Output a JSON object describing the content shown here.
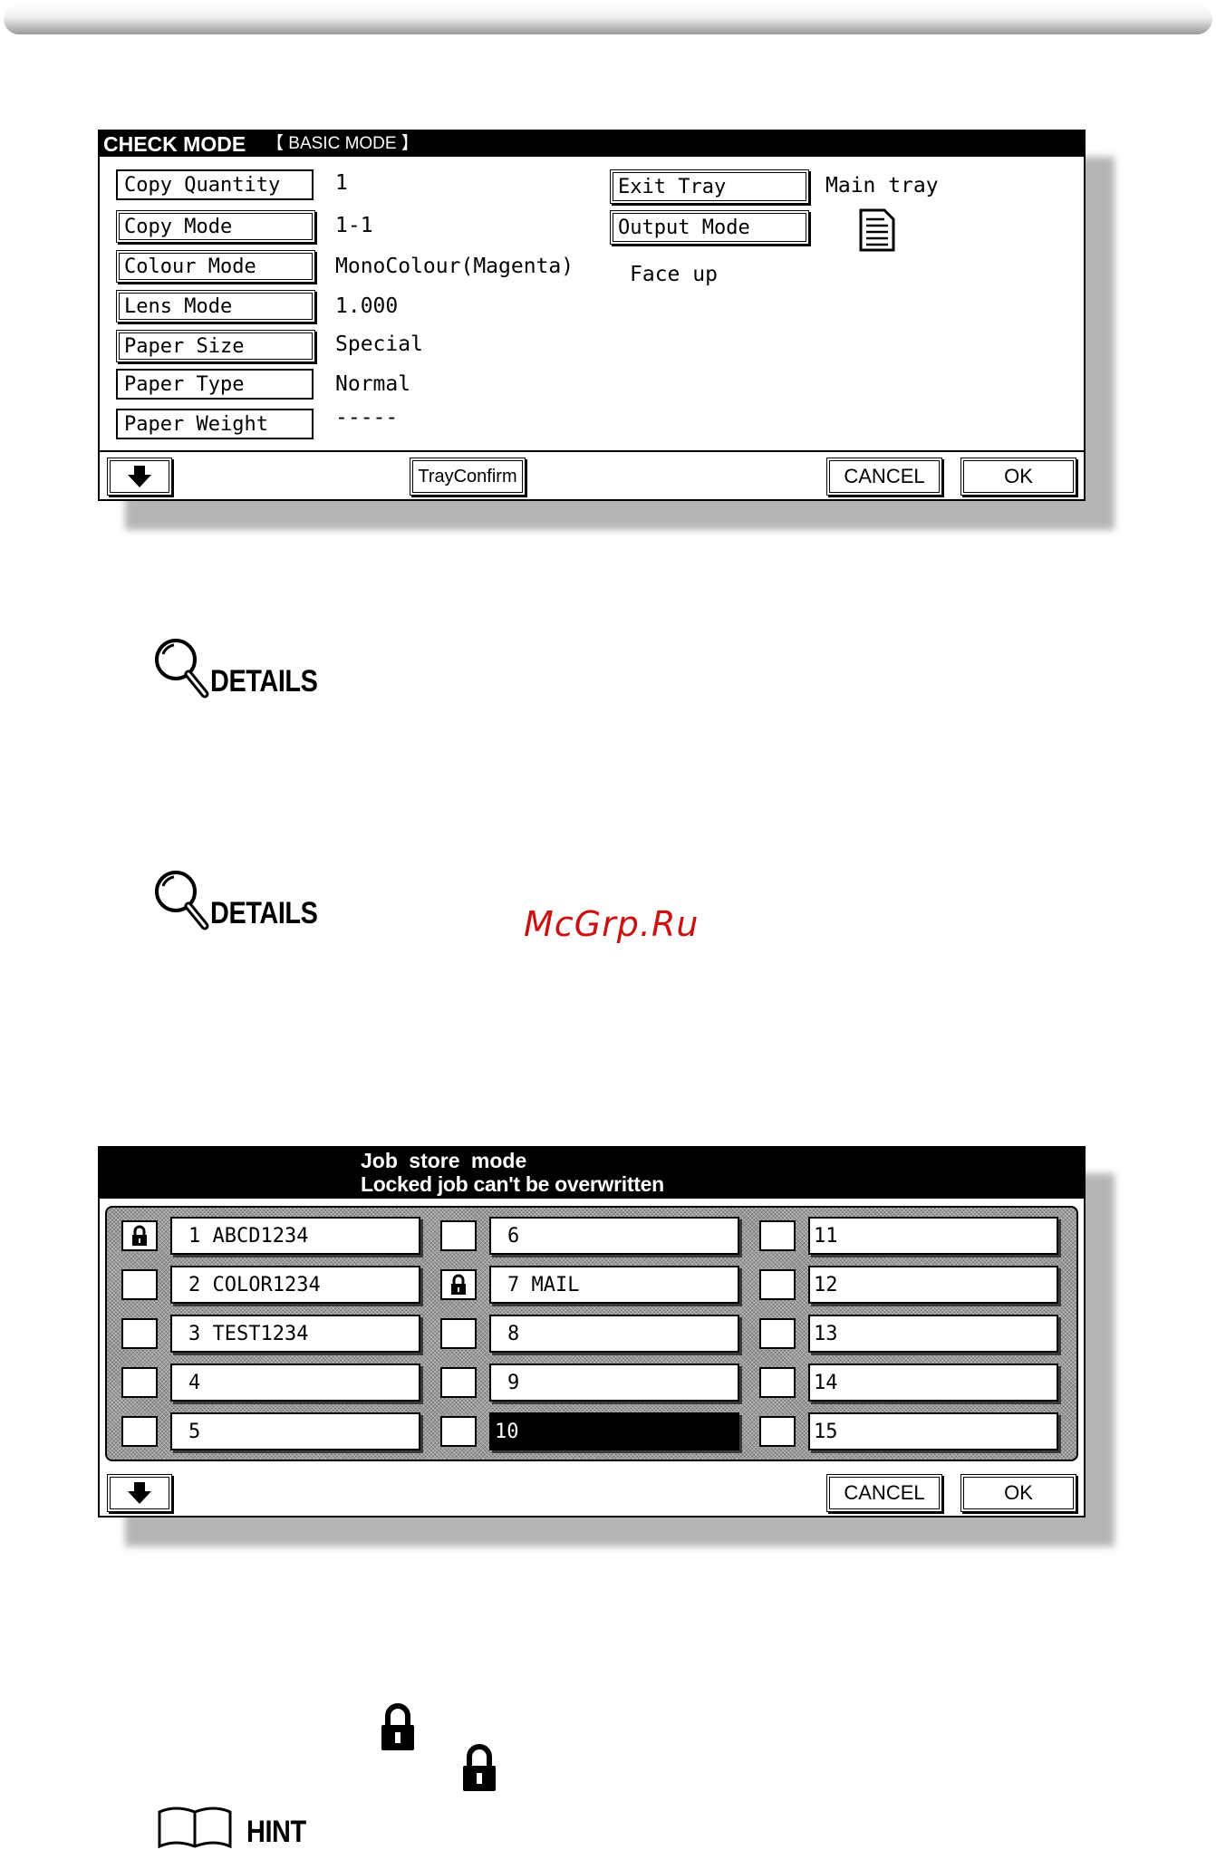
{
  "check_mode": {
    "title": "CHECK MODE",
    "subtitle": "【 BASIC MODE 】",
    "settings": [
      {
        "label": "Copy Quantity",
        "value": "1"
      },
      {
        "label": "Copy Mode",
        "value": "1-1"
      },
      {
        "label": "Colour Mode",
        "value": "MonoColour(Magenta)"
      },
      {
        "label": "Lens Mode",
        "value": "1.000"
      },
      {
        "label": "Paper Size",
        "value": "Special"
      },
      {
        "label": "Paper Type",
        "value": "Normal"
      },
      {
        "label": "Paper Weight",
        "value": "-----"
      }
    ],
    "exit_tray_label": "Exit Tray",
    "exit_tray_value": "Main tray",
    "output_mode_label": "Output Mode",
    "output_mode_value": "Face up",
    "tray_confirm_label": "TrayConfirm",
    "cancel_label": "CANCEL",
    "ok_label": "OK"
  },
  "details_1": {
    "label": "DETAILS"
  },
  "details_2": {
    "label": "DETAILS"
  },
  "watermark": "McGrp.Ru",
  "job_store": {
    "title_line1": "Job store mode",
    "title_line2": "Locked job can't be overwritten",
    "jobs": [
      {
        "label": "1 ABCD1234",
        "locked": true
      },
      {
        "label": "2 COLOR1234",
        "locked": false
      },
      {
        "label": "3 TEST1234",
        "locked": false
      },
      {
        "label": "4",
        "locked": false
      },
      {
        "label": "5",
        "locked": false
      },
      {
        "label": "6",
        "locked": false
      },
      {
        "label": "7 MAIL",
        "locked": true
      },
      {
        "label": "8",
        "locked": false
      },
      {
        "label": "9",
        "locked": false
      },
      {
        "label": "10",
        "locked": false,
        "selected": true
      },
      {
        "label": "11",
        "locked": false
      },
      {
        "label": "12",
        "locked": false
      },
      {
        "label": "13",
        "locked": false
      },
      {
        "label": "14",
        "locked": false
      },
      {
        "label": "15",
        "locked": false
      }
    ],
    "cancel_label": "CANCEL",
    "ok_label": "OK"
  },
  "hint": {
    "label": "HINT"
  },
  "colors": {
    "watermark": "#cc1111",
    "panel_header": "#000000"
  }
}
